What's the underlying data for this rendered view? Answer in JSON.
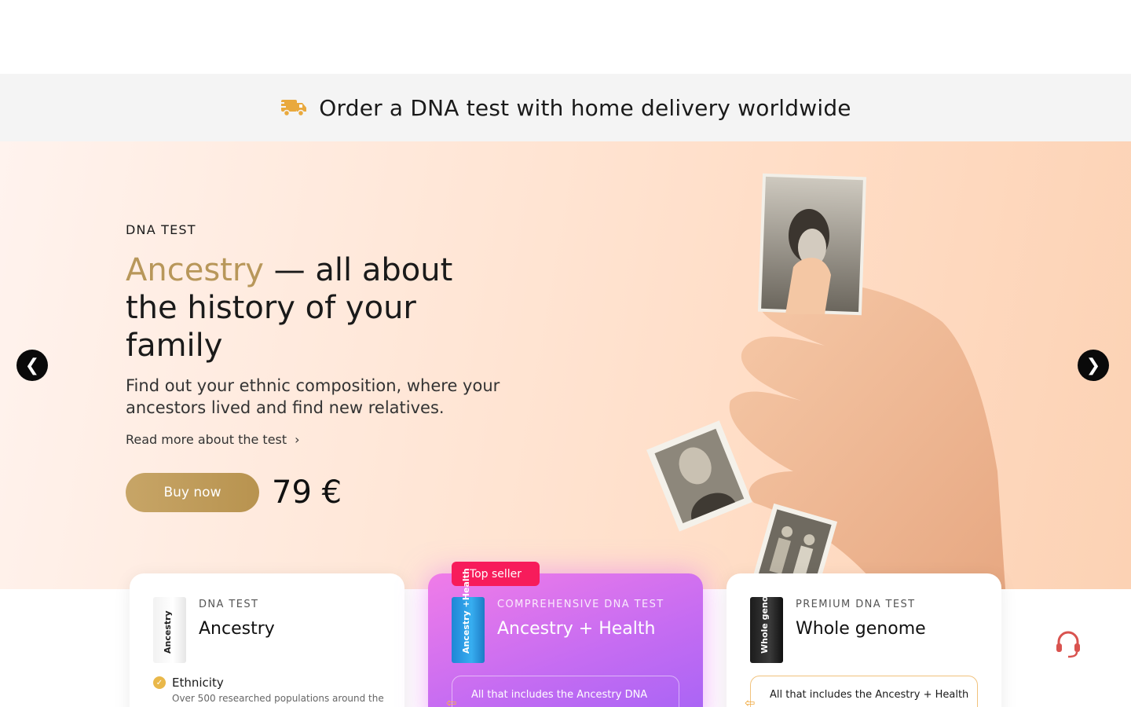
{
  "delivery_banner": {
    "icon": "delivery-truck-icon",
    "text": "Order a DNA test with home delivery worldwide"
  },
  "hero": {
    "eyebrow": "DNA TEST",
    "headline_accent": "Ancestry",
    "headline_rest": " — all about the history of your family",
    "lede": "Find out your ethnic composition, where your ancestors lived and find new relatives.",
    "read_more": "Read more about the test",
    "buy_label": "Buy now",
    "price": "79 €",
    "prev_label": "❮",
    "next_label": "❯",
    "accent_color": "#b8975a"
  },
  "cards": [
    {
      "eyebrow": "DNA TEST",
      "title": "Ancestry",
      "box_label": "Ancestry",
      "feature_title": "Ethnicity",
      "feature_desc": "Over 500 researched populations around the"
    },
    {
      "badge": "Top seller",
      "eyebrow": "COMPREHENSIVE DNA TEST",
      "title": "Ancestry + Health",
      "box_label": "Ancestry +Health",
      "includes": "All that includes the Ancestry DNA"
    },
    {
      "eyebrow": "PREMIUM DNA TEST",
      "title": "Whole genome",
      "box_label": "Whole genome",
      "includes": "All that includes the Ancestry + Health"
    }
  ],
  "support": {
    "icon": "support-headset-icon"
  },
  "colors": {
    "badge": "#f71c5b",
    "buy": "#c2a062",
    "check": "#e9b84a"
  }
}
